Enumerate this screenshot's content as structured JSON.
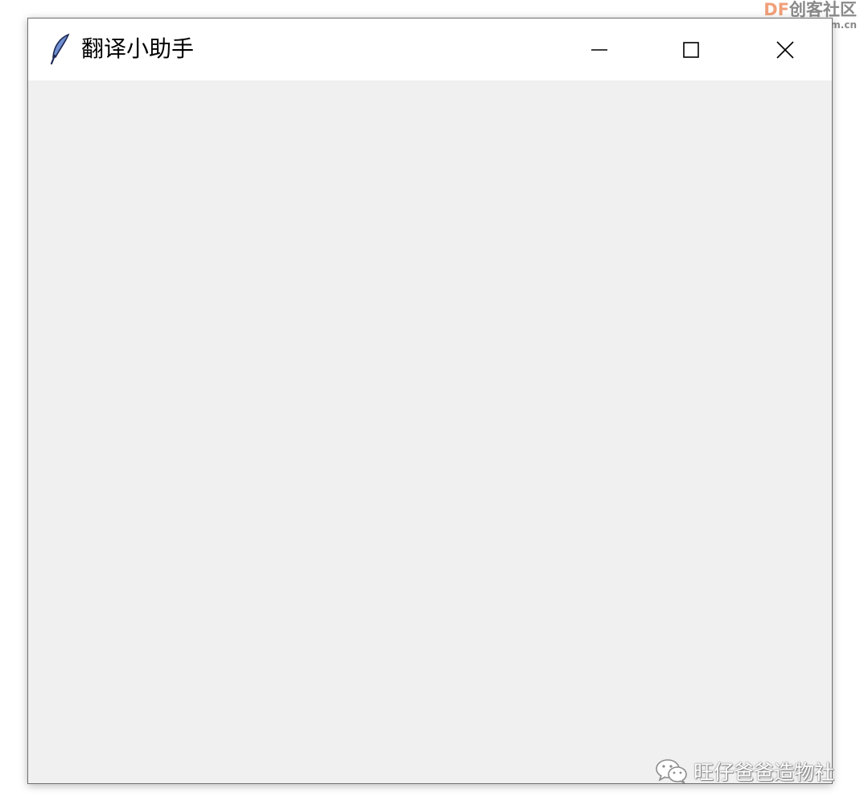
{
  "window": {
    "title": "翻译小助手",
    "icon": "feather-icon",
    "controls": {
      "minimize": "minimize-icon",
      "maximize": "maximize-icon",
      "close": "close-icon"
    }
  },
  "watermarks": {
    "df_prefix": "DF",
    "df_name": "创客社区",
    "df_url": "mc.DFRobot.com.cn",
    "wechat_icon": "wechat-icon",
    "wechat_account": "旺仔爸爸造物社"
  },
  "colors": {
    "window_bg": "#f0f0f0",
    "titlebar_bg": "#ffffff",
    "df_accent": "#f0a07a",
    "watermark_gray": "#8a8a8a"
  }
}
